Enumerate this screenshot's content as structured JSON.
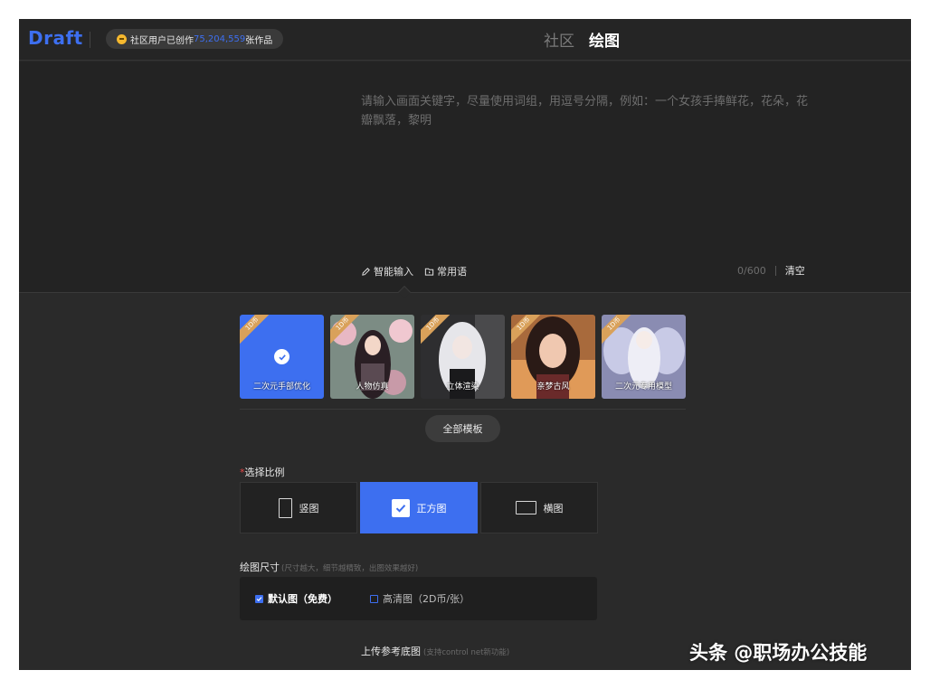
{
  "app": {
    "logo": "Draft",
    "stats_prefix": "社区用户已创作",
    "stats_count": "75,204,559",
    "stats_suffix": "张作品",
    "icon": "coin-icon"
  },
  "nav": {
    "tabs": [
      {
        "label": "社区",
        "active": false
      },
      {
        "label": "绘图",
        "active": true
      }
    ]
  },
  "prompt": {
    "placeholder": "请输入画面关键字，尽量使用词组，用逗号分隔，例如：一个女孩手捧鲜花，花朵，花瓣飘落，黎明",
    "smart_input": "智能输入",
    "common_phrases": "常用语",
    "char_count": "0/600",
    "clear": "清空"
  },
  "templates": {
    "items": [
      {
        "label": "二次元手部优化",
        "badge": "1D币",
        "selected": true
      },
      {
        "label": "人物仿真",
        "badge": "1D币",
        "selected": false
      },
      {
        "label": "立体渲染",
        "badge": "1D币",
        "selected": false
      },
      {
        "label": "亲梦古风",
        "badge": "1D币",
        "selected": false
      },
      {
        "label": "二次元专用模型",
        "badge": "1D币",
        "selected": false
      }
    ],
    "all_button": "全部模板"
  },
  "ratio": {
    "required_mark": "*",
    "title": "选择比例",
    "options": [
      {
        "label": "竖图",
        "icon": "portrait-icon",
        "active": false
      },
      {
        "label": "正方图",
        "icon": "square-check-icon",
        "active": true
      },
      {
        "label": "横图",
        "icon": "landscape-icon",
        "active": false
      }
    ]
  },
  "size": {
    "title": "绘图尺寸",
    "hint": "(尺寸越大，细节越精致，出图效果越好)",
    "options": [
      {
        "label": "默认图（免费）",
        "checked": true
      },
      {
        "label": "高清图（2D币/张）",
        "checked": false
      }
    ]
  },
  "upload": {
    "title": "上传参考底图",
    "hint": "(支持control net新功能)"
  },
  "watermark": "头条 @职场办公技能",
  "colors": {
    "accent": "#3d6ff0",
    "background": "#2a2a2a",
    "badge": "#d9a15a",
    "coin": "#f5b82e"
  }
}
